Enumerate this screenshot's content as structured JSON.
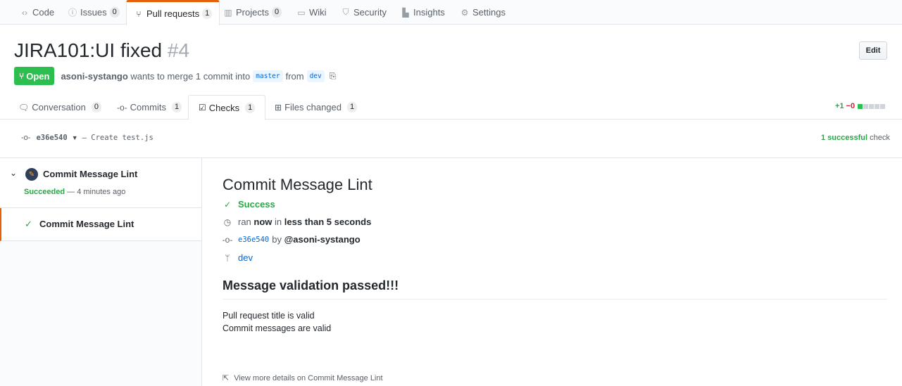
{
  "repo_nav": {
    "tabs": [
      {
        "label": "Code",
        "icon": "code-icon"
      },
      {
        "label": "Issues",
        "icon": "issue-icon",
        "count": "0"
      },
      {
        "label": "Pull requests",
        "icon": "pull-request-icon",
        "count": "1",
        "selected": true
      },
      {
        "label": "Projects",
        "icon": "project-icon",
        "count": "0"
      },
      {
        "label": "Wiki",
        "icon": "book-icon"
      },
      {
        "label": "Security",
        "icon": "shield-icon"
      },
      {
        "label": "Insights",
        "icon": "graph-icon"
      },
      {
        "label": "Settings",
        "icon": "gear-icon"
      }
    ],
    "accent": "#e36209"
  },
  "pr": {
    "title": "JIRA101:UI fixed",
    "number": "#4",
    "edit_label": "Edit",
    "state": "Open",
    "state_color": "#2cbe4e",
    "author": "asoni-systango",
    "merge_text": "wants to merge",
    "commit_count": "1 commit",
    "into": "into",
    "base_branch": "master",
    "from": "from",
    "head_branch": "dev"
  },
  "pr_tabs": [
    {
      "label": "Conversation",
      "icon": "comment-icon",
      "count": "0"
    },
    {
      "label": "Commits",
      "icon": "commit-icon",
      "count": "1"
    },
    {
      "label": "Checks",
      "icon": "checklist-icon",
      "count": "1",
      "selected": true
    },
    {
      "label": "Files changed",
      "icon": "file-diff-icon",
      "count": "1"
    }
  ],
  "diffstat": {
    "additions": "+1",
    "deletions": "−0",
    "blocks_green": 1,
    "blocks_total": 5
  },
  "commit_bar": {
    "sha": "e36e540",
    "message": "— Create test.js",
    "successful": "1 successful",
    "check_word": "check"
  },
  "sidebar": {
    "suite_name": "Commit Message Lint",
    "status": "Succeeded",
    "time": "— 4 minutes ago",
    "run_name": "Commit Message Lint"
  },
  "check_run": {
    "title": "Commit Message Lint",
    "conclusion": "Success",
    "ran": "ran",
    "now": "now",
    "in": "in",
    "duration": "less than 5 seconds",
    "sha": "e36e540",
    "by": "by",
    "user": "@asoni-systango",
    "branch": "dev",
    "summary_heading": "Message validation passed!!!",
    "summary_lines": [
      "Pull request title is valid",
      "Commit messages are valid"
    ],
    "details_link": "View more details on Commit Message Lint"
  }
}
